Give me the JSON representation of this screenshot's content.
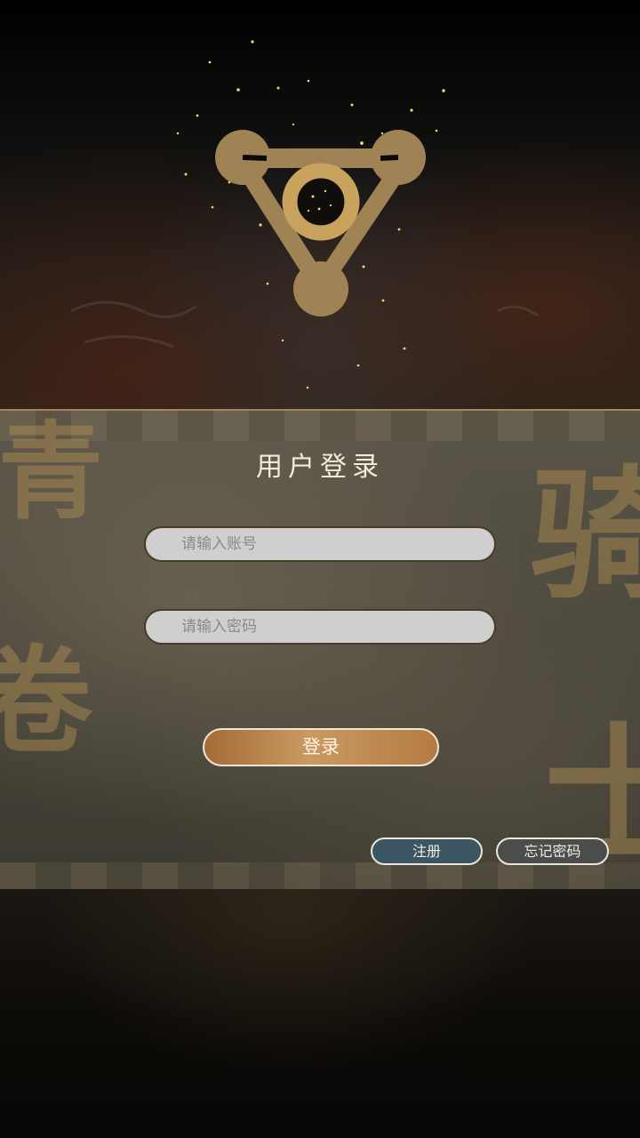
{
  "brand": {
    "accent": "#a08355",
    "button_gradient": "#b47b42",
    "register_color": "#3b5563",
    "forgot_color": "#4c4c4b"
  },
  "header": {
    "logo_icon": "triangle-ring-logo-icon"
  },
  "login_panel": {
    "title": "用户登录",
    "account_placeholder": "请输入账号",
    "password_placeholder": "请输入密码",
    "login_label": "登录",
    "register_label": "注册",
    "forgot_label": "忘记密码",
    "decorative_chars": [
      "青",
      "卷",
      "骑",
      "士"
    ]
  }
}
